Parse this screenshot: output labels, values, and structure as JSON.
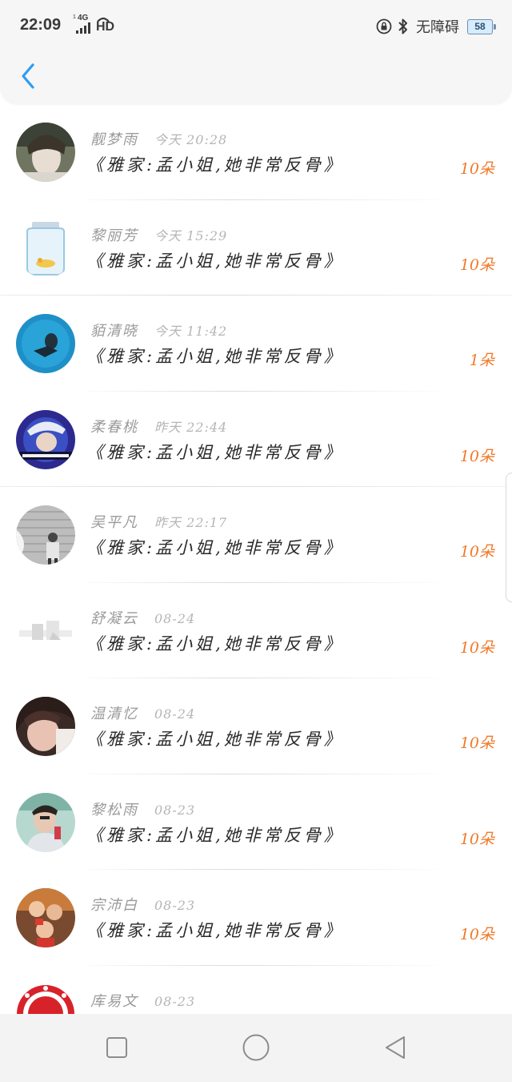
{
  "status_bar": {
    "time": "22:09",
    "network_type": "4G",
    "network_hd": "HD",
    "accessibility_label": "无障碍",
    "battery": "58"
  },
  "header": {
    "back_icon": "chevron-left-icon"
  },
  "colors": {
    "accent": "#2f9cf2",
    "gift_orange": "#f07a2a",
    "name_gray": "#9a9a9a",
    "message_text": "#2a2a2a"
  },
  "list": [
    {
      "name": "靓梦雨",
      "time": "今天 20:28",
      "message": "《雅家:孟小姐,她非常反骨》",
      "gift": "10朵"
    },
    {
      "name": "黎丽芳",
      "time": "今天 15:29",
      "message": "《雅家:孟小姐,她非常反骨》",
      "gift": "10朵"
    },
    {
      "name": "貊清晓",
      "time": "今天 11:42",
      "message": "《雅家:孟小姐,她非常反骨》",
      "gift": "1朵"
    },
    {
      "name": "柔春桃",
      "time": "昨天 22:44",
      "message": "《雅家:孟小姐,她非常反骨》",
      "gift": "10朵"
    },
    {
      "name": "吴平凡",
      "time": "昨天 22:17",
      "message": "《雅家:孟小姐,她非常反骨》",
      "gift": "10朵"
    },
    {
      "name": "舒凝云",
      "time": "08-24",
      "message": "《雅家:孟小姐,她非常反骨》",
      "gift": "10朵"
    },
    {
      "name": "温清忆",
      "time": "08-24",
      "message": "《雅家:孟小姐,她非常反骨》",
      "gift": "10朵"
    },
    {
      "name": "黎松雨",
      "time": "08-23",
      "message": "《雅家:孟小姐,她非常反骨》",
      "gift": "10朵"
    },
    {
      "name": "宗沛白",
      "time": "08-23",
      "message": "《雅家:孟小姐,她非常反骨》",
      "gift": "10朵"
    },
    {
      "name": "库易文",
      "time": "08-23",
      "message": "",
      "gift": ""
    }
  ],
  "navbar": {
    "recents_icon": "square-icon",
    "home_icon": "circle-icon",
    "back_icon": "triangle-back-icon"
  }
}
